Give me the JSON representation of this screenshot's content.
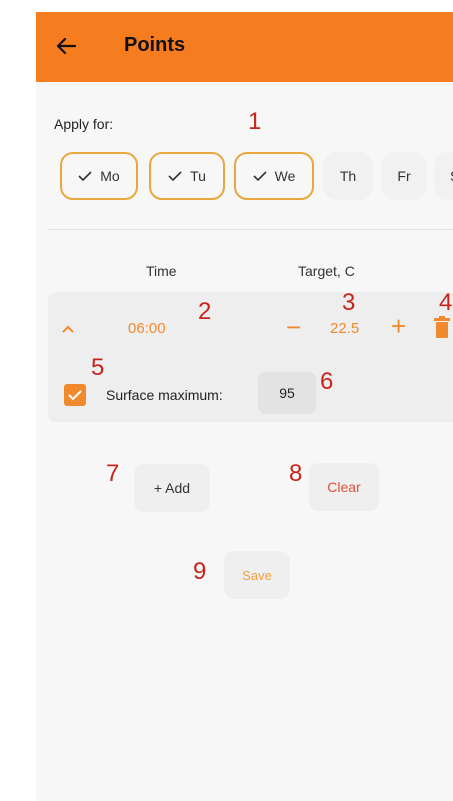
{
  "appbar": {
    "title": "Points",
    "back_icon": "arrow-left-icon",
    "background": "#f57c1f"
  },
  "apply": {
    "label": "Apply for:",
    "days": [
      {
        "label": "Mo",
        "selected": true
      },
      {
        "label": "Tu",
        "selected": true
      },
      {
        "label": "We",
        "selected": true
      },
      {
        "label": "Th",
        "selected": false
      },
      {
        "label": "Fr",
        "selected": false
      },
      {
        "label": "S",
        "selected": false
      }
    ]
  },
  "columns": {
    "time": "Time",
    "target": "Target, C"
  },
  "point": {
    "time": "06:00",
    "target": "22.5",
    "minus": "−",
    "plus": "+",
    "surface_label": "Surface maximum:",
    "surface_value": "95",
    "surface_checked": true
  },
  "actions": {
    "add": "+ Add",
    "clear": "Clear",
    "save": "Save"
  },
  "annotations": [
    "1",
    "2",
    "3",
    "4",
    "5",
    "6",
    "7",
    "8",
    "9"
  ],
  "colors": {
    "accent": "#f08a2c",
    "chip_border": "#e9a73d",
    "annotation": "#c8241c"
  }
}
